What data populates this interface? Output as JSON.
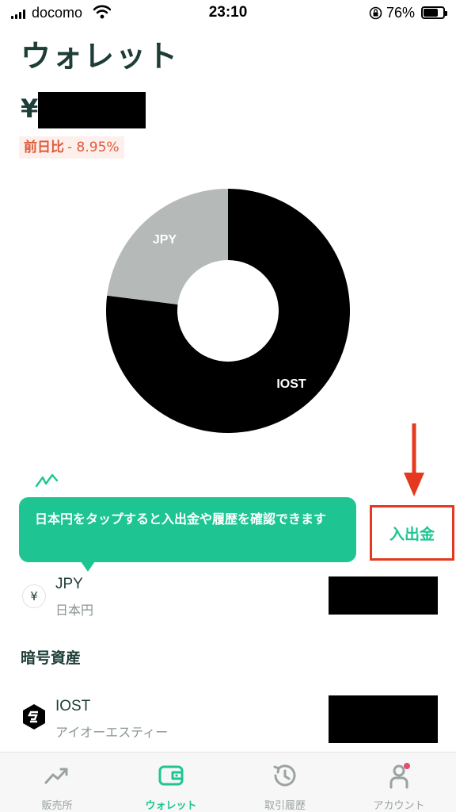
{
  "status_bar": {
    "carrier": "docomo",
    "time": "23:10",
    "battery_percent": "76%",
    "battery_level": 0.76
  },
  "header": {
    "title": "ウォレット"
  },
  "balance": {
    "currency_symbol": "¥",
    "change_label": "前日比",
    "change_value": "- 8.95%"
  },
  "chart_data": {
    "type": "pie",
    "categories": [
      "IOST",
      "JPY"
    ],
    "values": [
      77,
      23
    ],
    "colors": [
      "#000000",
      "#b5b9b8"
    ],
    "label_colors": [
      "#ffffff",
      "#ffffff"
    ]
  },
  "tooltip": {
    "text": "日本円をタップすると入出金や履歴を確認できます"
  },
  "deposit_withdraw": {
    "label": "入出金"
  },
  "fiat": {
    "icon_glyph": "¥",
    "symbol": "JPY",
    "name": "日本円"
  },
  "crypto_section": {
    "heading": "暗号資産",
    "items": [
      {
        "symbol": "IOST",
        "name": "アイオーエスティー"
      }
    ]
  },
  "tab_bar": {
    "tabs": [
      {
        "label": "販売所",
        "icon": "chart-up-icon",
        "active": false
      },
      {
        "label": "ウォレット",
        "icon": "wallet-icon",
        "active": true
      },
      {
        "label": "取引履歴",
        "icon": "history-icon",
        "active": false
      },
      {
        "label": "アカウント",
        "icon": "account-icon",
        "active": false
      }
    ]
  },
  "colors": {
    "accent": "#1ec592",
    "negative": "#e05a3a",
    "annotation": "#e5391f",
    "text": "#1e3d37"
  }
}
